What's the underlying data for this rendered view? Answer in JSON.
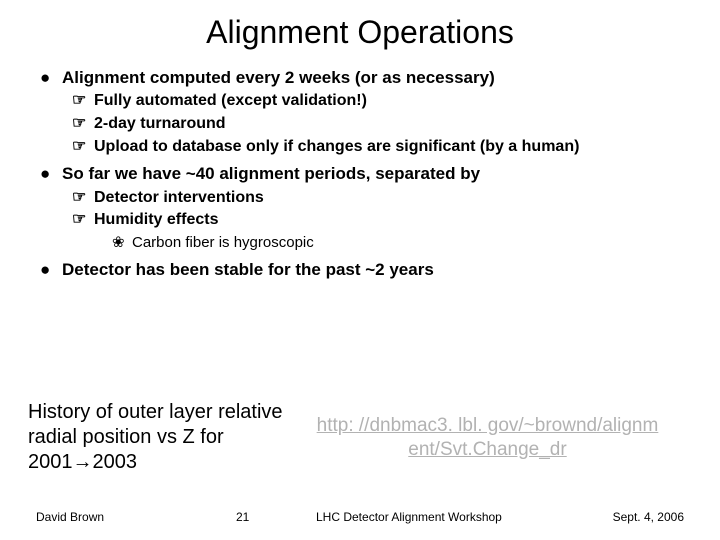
{
  "title": "Alignment Operations",
  "bullets": {
    "b1": "Alignment computed every 2 weeks (or as necessary)",
    "b1a": "Fully automated (except validation!)",
    "b1b": "2-day turnaround",
    "b1c": "Upload to database only if changes are significant (by a human)",
    "b2": "So far we have ~40 alignment periods, separated by",
    "b2a": "Detector interventions",
    "b2b": "Humidity effects",
    "b2b1": "Carbon fiber is hygroscopic",
    "b3": "Detector has been stable for the past ~2 years"
  },
  "history": {
    "caption": "History of outer layer relative radial position vs Z  for 2001→2003",
    "link": "http: //dnbmac3. lbl. gov/~brownd/alignm ent/Svt.Change_dr"
  },
  "footer": {
    "author": "David Brown",
    "page": "21",
    "venue": "LHC Detector Alignment Workshop",
    "date": "Sept. 4, 2006"
  },
  "glyphs": {
    "disc": "●",
    "hand": "☞",
    "flower": "❀"
  }
}
